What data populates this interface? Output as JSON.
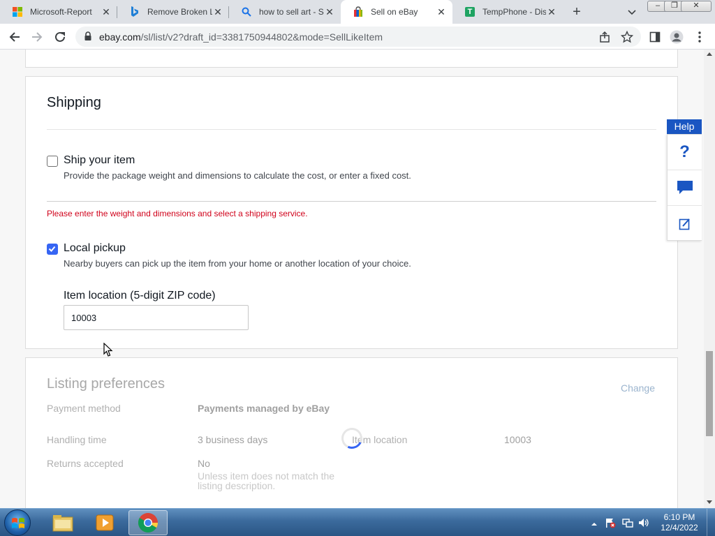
{
  "browser": {
    "tabs": [
      {
        "title": "Microsoft-Report",
        "icon": "microsoft-icon",
        "active": false
      },
      {
        "title": "Remove Broken Li",
        "icon": "bing-icon",
        "active": false
      },
      {
        "title": "how to sell art - S",
        "icon": "search-icon",
        "active": false
      },
      {
        "title": "Sell on eBay",
        "icon": "ebay-bag-icon",
        "active": true
      },
      {
        "title": "TempPhone - Disp",
        "icon": "tempphone-icon",
        "active": false
      }
    ],
    "tempphone_letter": "T",
    "url_host": "ebay.com",
    "url_path": "/sl/list/v2?draft_id=3381750944802&mode=SellLikeItem"
  },
  "shipping": {
    "title": "Shipping",
    "ship_item": {
      "label": "Ship your item",
      "description": "Provide the package weight and dimensions to calculate the cost, or enter a fixed cost.",
      "checked": false
    },
    "error": "Please enter the weight and dimensions and select a shipping service.",
    "local_pickup": {
      "label": "Local pickup",
      "description": "Nearby buyers can pick up the item from your home or another location of your choice.",
      "checked": true
    },
    "location_label": "Item location (5-digit ZIP code)",
    "zip_value": "10003"
  },
  "listing_preferences": {
    "title": "Listing preferences",
    "change_label": "Change",
    "payment_label": "Payment method",
    "payment_value": "Payments managed by eBay",
    "handling_label": "Handling time",
    "handling_value": "3 business days",
    "item_location_label": "Item location",
    "item_location_value": "10003",
    "returns_label": "Returns accepted",
    "returns_value": "No",
    "returns_note": "Unless item does not match the listing description."
  },
  "help": {
    "tab_label": "Help",
    "question_glyph": "?"
  },
  "taskbar": {
    "time": "6:10 PM",
    "date": "12/4/2022"
  },
  "colors": {
    "ebay_blue": "#3665f3",
    "error_red": "#d0021b",
    "help_blue": "#1a56c2"
  }
}
